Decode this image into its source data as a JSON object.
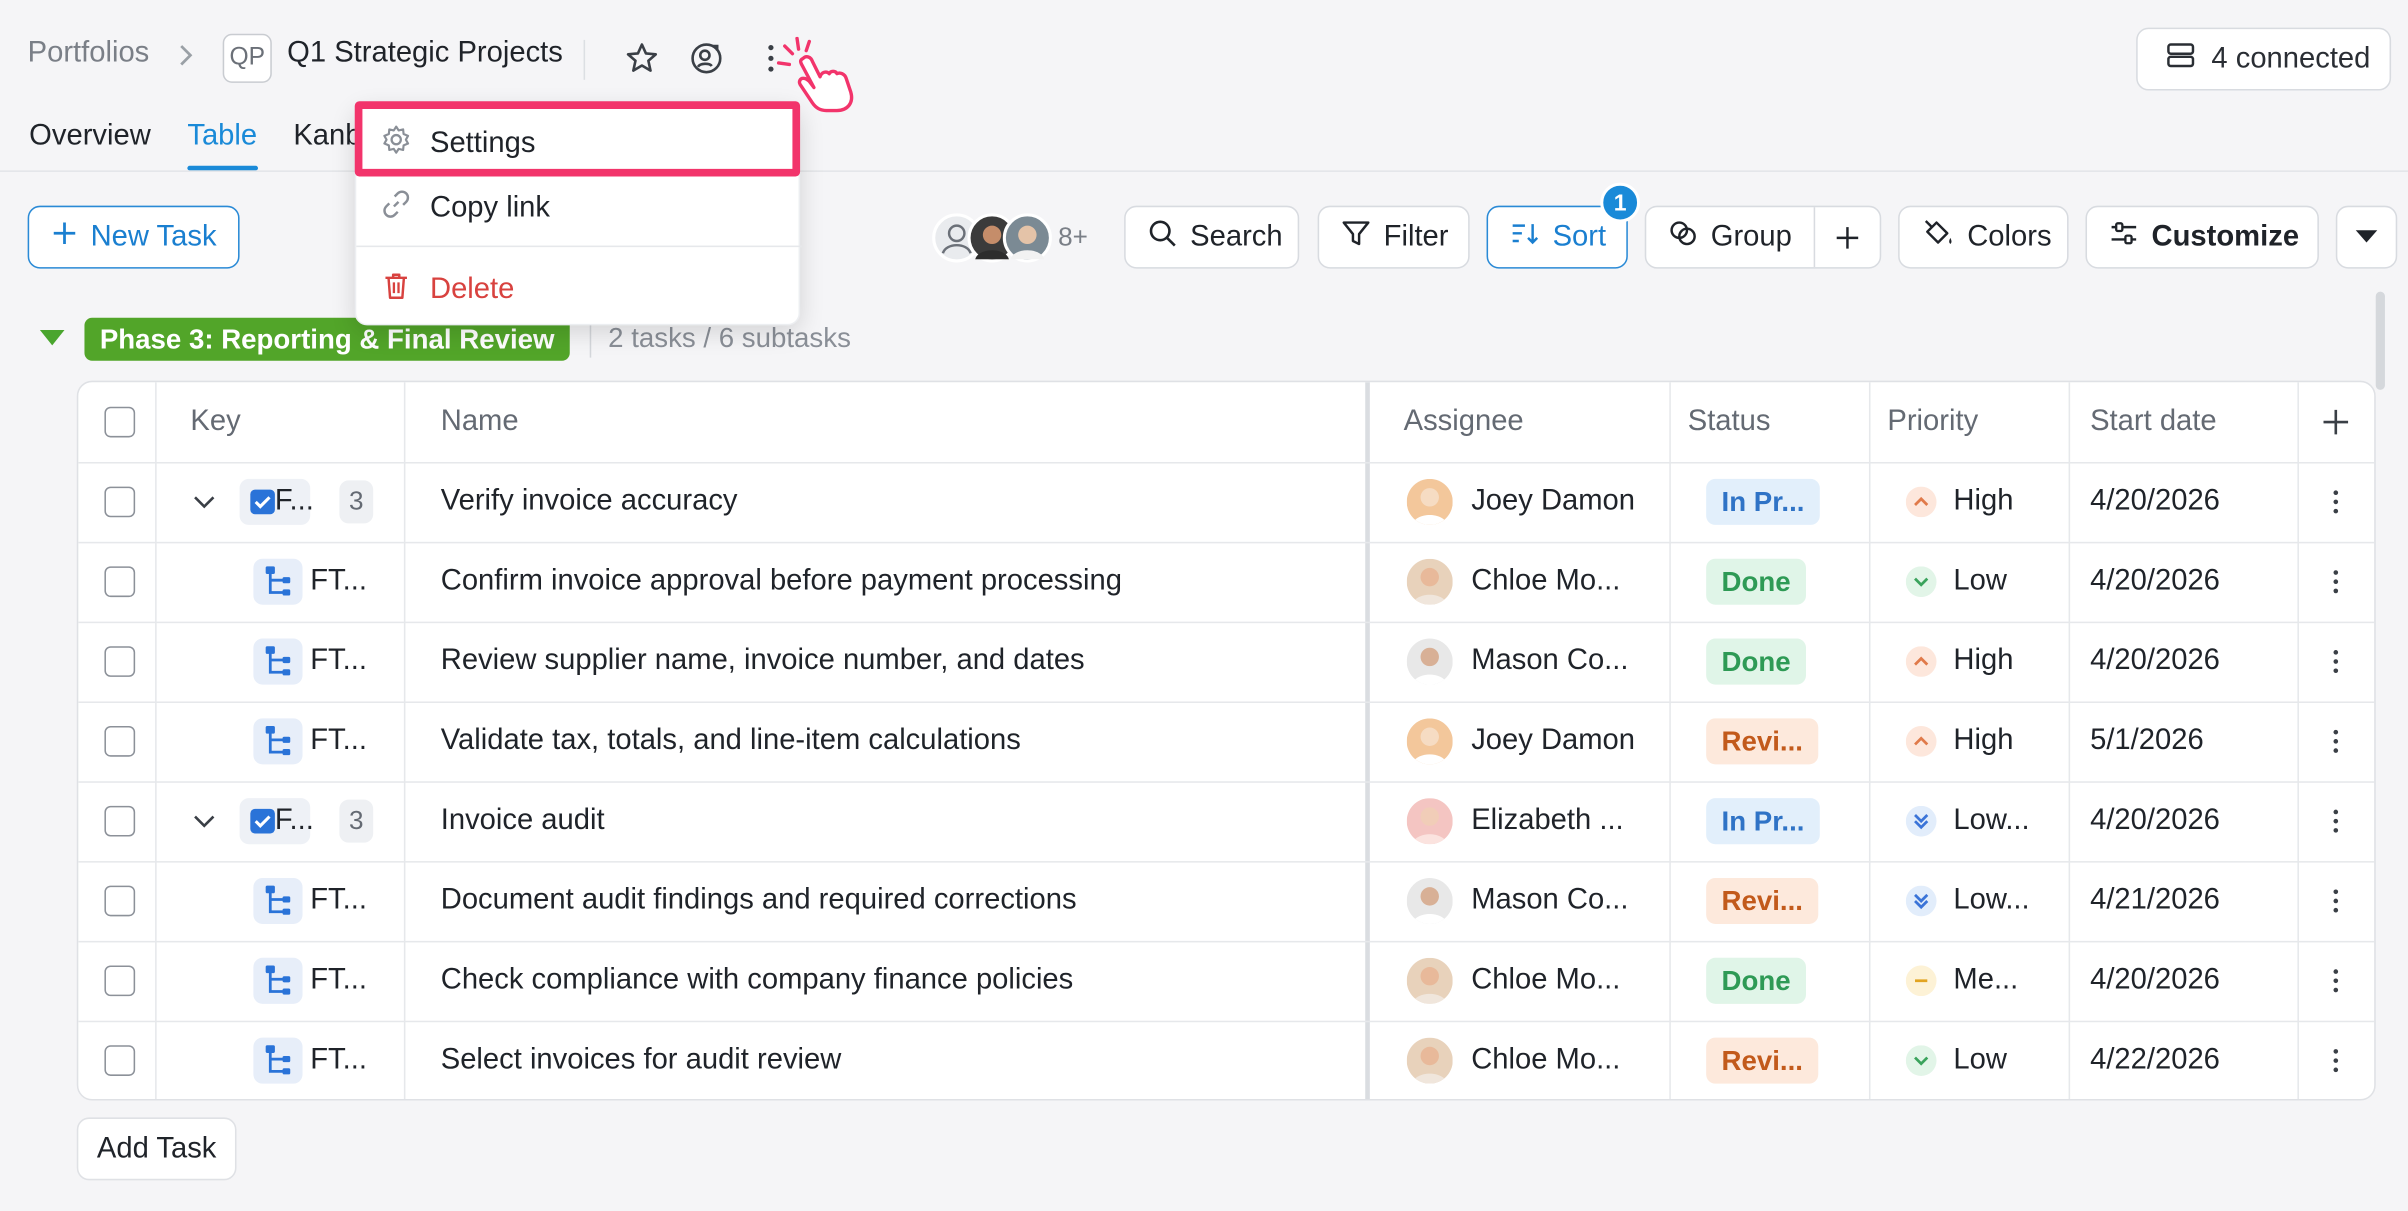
{
  "breadcrumb": {
    "portfolios": "Portfolios",
    "project_badge": "QP",
    "project_title": "Q1 Strategic Projects"
  },
  "header": {
    "connected_label": "4 connected"
  },
  "tabs": [
    {
      "label": "Overview",
      "active": false
    },
    {
      "label": "Table",
      "active": true
    },
    {
      "label": "Kanb",
      "active": false
    }
  ],
  "menu": {
    "items": [
      {
        "label": "Settings",
        "icon": "gear-icon"
      },
      {
        "label": "Copy link",
        "icon": "link-icon"
      },
      {
        "label": "Delete",
        "icon": "trash-icon"
      }
    ]
  },
  "toolbar": {
    "new_task": "New Task",
    "avatars_more": "8+",
    "search": "Search",
    "filter": "Filter",
    "sort": "Sort",
    "sort_badge": "1",
    "group": "Group",
    "colors": "Colors",
    "customize": "Customize"
  },
  "phase": {
    "name": "Phase 3: Reporting & Final Review",
    "count": "2 tasks / 6 subtasks",
    "color": "#52a529"
  },
  "table": {
    "columns": [
      "Key",
      "Name",
      "Assignee",
      "Status",
      "Priority",
      "Start date"
    ],
    "rows": [
      {
        "type": "parent",
        "key": "F...",
        "subcount": "3",
        "name": "Verify invoice accuracy",
        "assignee": "Joey Damon",
        "status": "In Pr...",
        "status_kind": "inprog",
        "priority": "High",
        "priority_kind": "high",
        "start": "4/20/2026"
      },
      {
        "type": "sub",
        "key": "FT...",
        "name": "Confirm invoice approval before payment processing",
        "assignee": "Chloe Mo...",
        "status": "Done",
        "status_kind": "done",
        "priority": "Low",
        "priority_kind": "low",
        "start": "4/20/2026"
      },
      {
        "type": "sub",
        "key": "FT...",
        "name": "Review supplier name, invoice number, and dates",
        "assignee": "Mason Co...",
        "status": "Done",
        "status_kind": "done",
        "priority": "High",
        "priority_kind": "high",
        "start": "4/20/2026"
      },
      {
        "type": "sub",
        "key": "FT...",
        "name": "Validate tax, totals, and line-item calculations",
        "assignee": "Joey Damon",
        "status": "Revi...",
        "status_kind": "review",
        "priority": "High",
        "priority_kind": "high",
        "start": "5/1/2026"
      },
      {
        "type": "parent",
        "key": "F...",
        "subcount": "3",
        "name": "Invoice audit",
        "assignee": "Elizabeth ...",
        "status": "In Pr...",
        "status_kind": "inprog",
        "priority": "Low...",
        "priority_kind": "lowest",
        "start": "4/20/2026"
      },
      {
        "type": "sub",
        "key": "FT...",
        "name": "Document audit findings and required corrections",
        "assignee": "Mason Co...",
        "status": "Revi...",
        "status_kind": "review",
        "priority": "Low...",
        "priority_kind": "lowest",
        "start": "4/21/2026"
      },
      {
        "type": "sub",
        "key": "FT...",
        "name": "Check compliance with company finance policies",
        "assignee": "Chloe Mo...",
        "status": "Done",
        "status_kind": "done",
        "priority": "Me...",
        "priority_kind": "medium",
        "start": "4/20/2026"
      },
      {
        "type": "sub",
        "key": "FT...",
        "name": "Select invoices for audit review",
        "assignee": "Chloe Mo...",
        "status": "Revi...",
        "status_kind": "review",
        "priority": "Low",
        "priority_kind": "low",
        "start": "4/22/2026"
      }
    ]
  },
  "footer": {
    "add_task": "Add Task"
  },
  "colors": {
    "accent": "#1a8ad8",
    "highlight": "#f2346b",
    "delete": "#d8423f"
  }
}
